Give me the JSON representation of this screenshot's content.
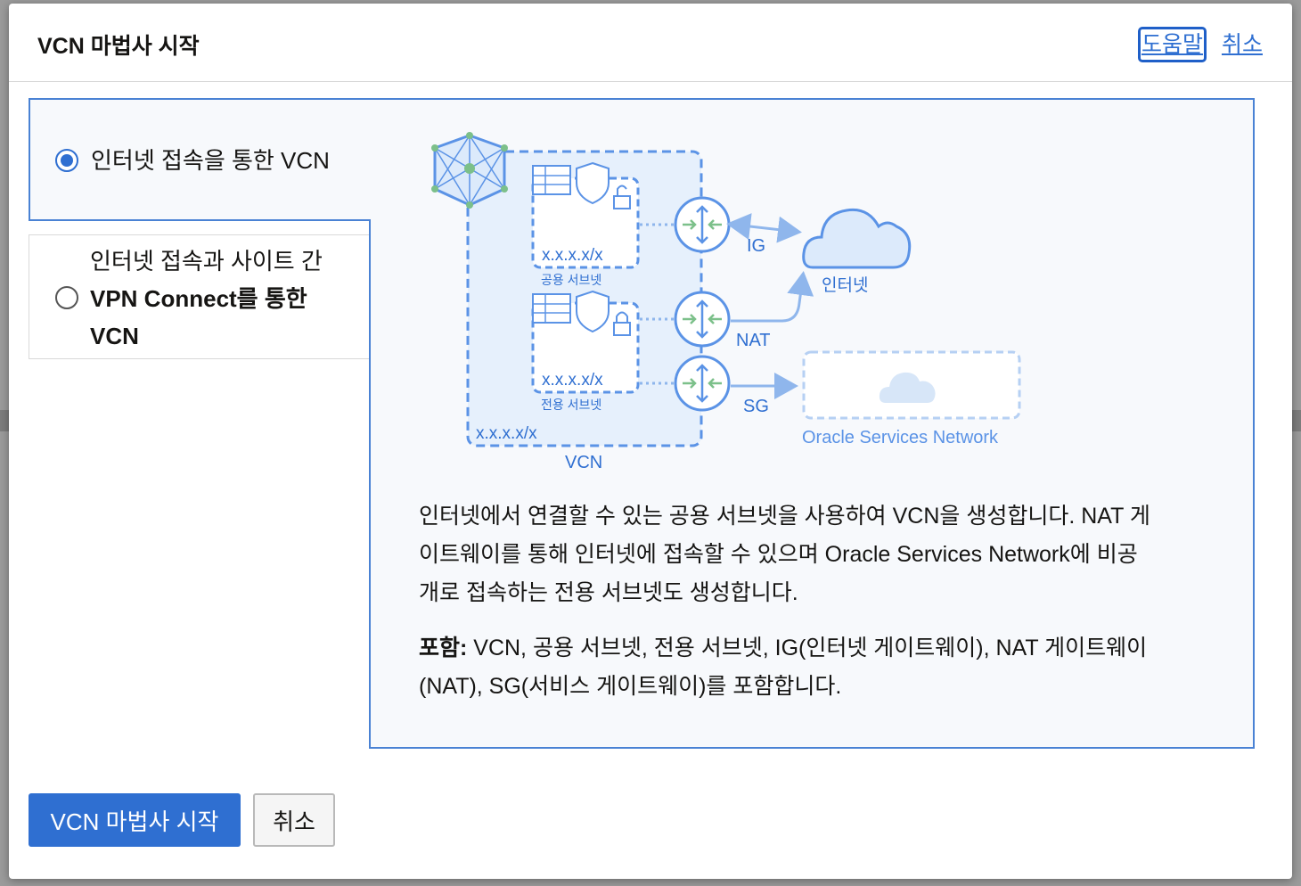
{
  "modal": {
    "title": "VCN 마법사 시작",
    "help_link": "도움말",
    "cancel_link": "취소"
  },
  "options": [
    {
      "label": "인터넷 접속을 통한 VCN",
      "selected": true
    },
    {
      "label_lines": [
        "인터넷 접속과 사이트 간",
        "VPN Connect를 통한",
        "VCN"
      ],
      "selected": false
    }
  ],
  "diagram": {
    "public_subnet_cidr": "x.x.x.x/x",
    "public_subnet_label": "공용 서브넷",
    "private_subnet_cidr": "x.x.x.x/x",
    "private_subnet_label": "전용 서브넷",
    "vcn_cidr": "x.x.x.x/x",
    "vcn_label": "VCN",
    "ig_label": "IG",
    "nat_label": "NAT",
    "sg_label": "SG",
    "internet_label": "인터넷",
    "osn_label": "Oracle Services Network"
  },
  "description_lines": [
    "인터넷에서 연결할 수 있는 공용 서브넷을 사용하여 VCN을 생성합니다. NAT 게",
    "이트웨이를 통해 인터넷에 접속할 수 있으며 Oracle Services Network에 비공",
    "개로 접속하는 전용 서브넷도 생성합니다."
  ],
  "includes": {
    "label": "포함:",
    "line1": " VCN, 공용 서브넷, 전용 서브넷, IG(인터넷 게이트웨이), NAT 게이트웨이",
    "line2": "(NAT), SG(서비스 게이트웨이)를 포함합니다."
  },
  "footer": {
    "start_button": "VCN 마법사 시작",
    "cancel_button": "취소"
  },
  "colors": {
    "accent": "#2f6fd1",
    "panel_border": "#4a82d4",
    "diagram_blue": "#5b93e6",
    "diagram_fill": "#e6f0fc",
    "router_green": "#7cc08a"
  }
}
